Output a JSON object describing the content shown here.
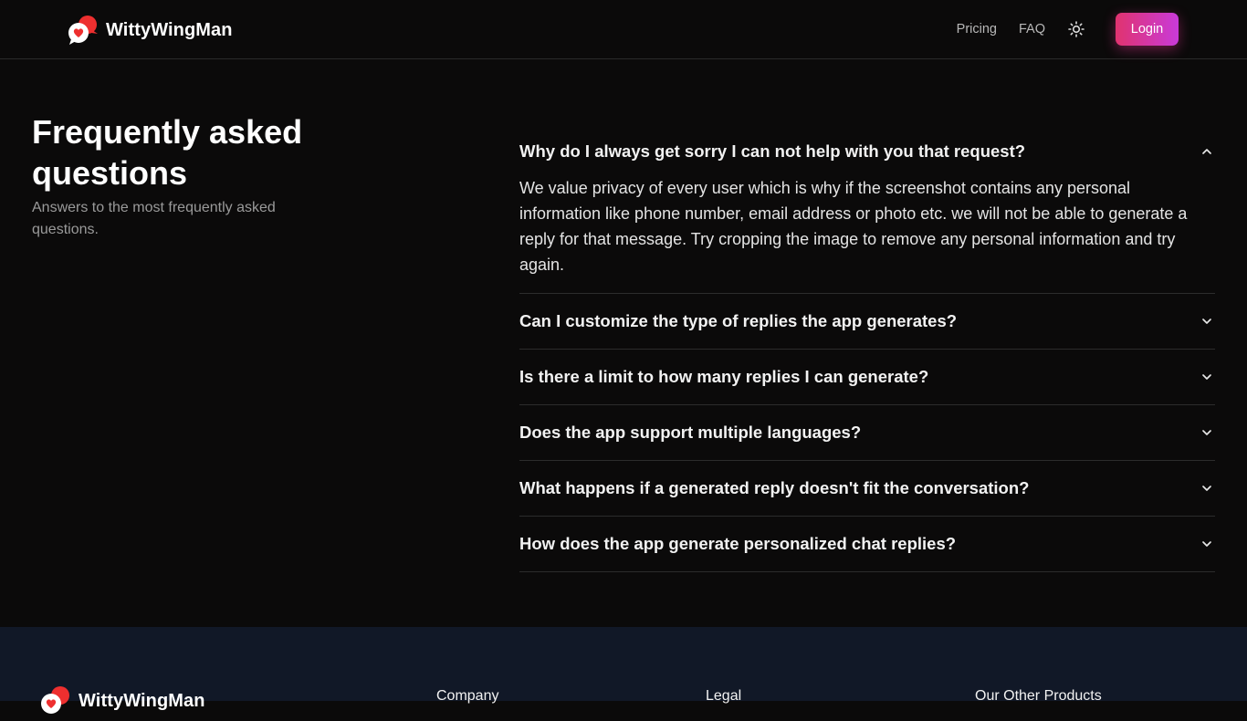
{
  "header": {
    "brand": "WittyWingMan",
    "nav": {
      "pricing": "Pricing",
      "faq": "FAQ",
      "login": "Login"
    }
  },
  "faq": {
    "title": "Frequently asked questions",
    "subtitle": "Answers to the most frequently asked questions.",
    "items": [
      {
        "question": "Why do I always get sorry I can not help with you that request?",
        "answer": "We value privacy of every user which is why if the screenshot contains any personal information like phone number, email address or photo etc. we will not be able to generate a reply for that message. Try cropping the image to remove any personal information and try again.",
        "expanded": true
      },
      {
        "question": "Can I customize the type of replies the app generates?",
        "expanded": false
      },
      {
        "question": "Is there a limit to how many replies I can generate?",
        "expanded": false
      },
      {
        "question": "Does the app support multiple languages?",
        "expanded": false
      },
      {
        "question": "What happens if a generated reply doesn't fit the conversation?",
        "expanded": false
      },
      {
        "question": "How does the app generate personalized chat replies?",
        "expanded": false
      }
    ]
  },
  "footer": {
    "brand": "WittyWingMan",
    "columns": [
      "Company",
      "Legal",
      "Our Other Products"
    ]
  },
  "icons": {
    "logo": "speech-bubbles-heart-icon",
    "theme": "sun-icon",
    "expanded": "chevron-up-icon",
    "collapsed": "chevron-down-icon"
  },
  "colors": {
    "background": "#0b0a0a",
    "footer_background": "#111827",
    "login_gradient_start": "#e0336f",
    "login_gradient_end": "#c93ad9",
    "logo_red": "#ee2f2f"
  }
}
